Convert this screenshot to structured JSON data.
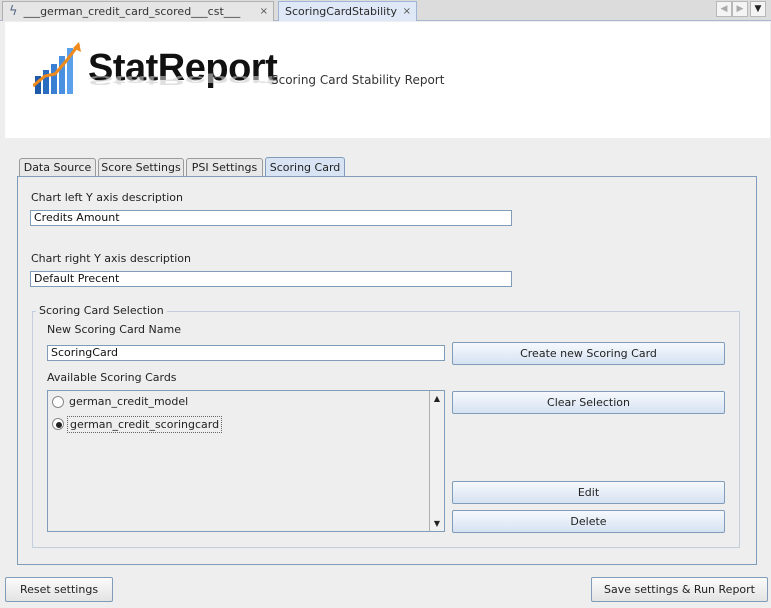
{
  "editor_tabs": [
    {
      "label": "___german_credit_card_scored___cst___",
      "close": "×"
    },
    {
      "label": "ScoringCardStability",
      "close": "×"
    }
  ],
  "header": {
    "logo_text": "StatReport",
    "subtitle": "Scoring Card Stability Report"
  },
  "tabs": [
    {
      "label": "Data Source"
    },
    {
      "label": "Score Settings"
    },
    {
      "label": "PSI Settings"
    },
    {
      "label": "Scoring Card"
    }
  ],
  "form": {
    "left_axis_label": "Chart left Y axis description",
    "left_axis_value": "Credits Amount",
    "right_axis_label": "Chart right Y axis description",
    "right_axis_value": "Default Precent"
  },
  "selection": {
    "group_title": "Scoring Card Selection",
    "new_name_label": "New Scoring Card Name",
    "new_name_value": "ScoringCard",
    "create_button": "Create new Scoring Card",
    "available_label": "Available Scoring Cards",
    "cards": [
      {
        "label": "german_credit_model",
        "selected": false
      },
      {
        "label": "german_credit_scoringcard",
        "selected": true
      }
    ],
    "clear_button": "Clear Selection",
    "edit_button": "Edit",
    "delete_button": "Delete"
  },
  "footer": {
    "reset_button": "Reset settings",
    "run_button": "Save settings & Run Report"
  },
  "colors": {
    "accent_border": "#7f9db9",
    "active_tab": "#d8e4f3"
  }
}
